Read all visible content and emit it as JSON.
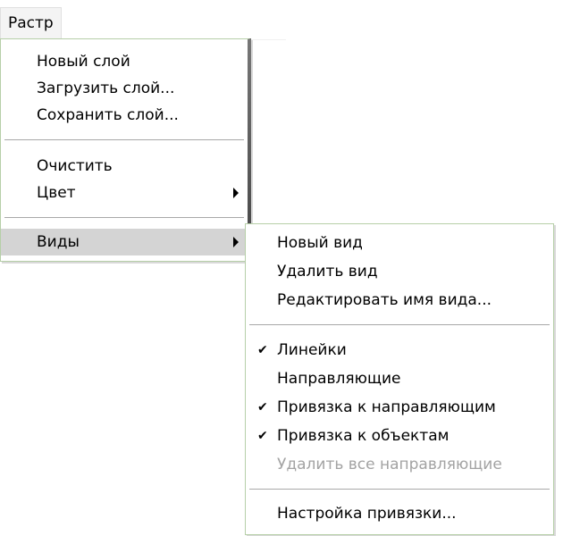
{
  "menubar": {
    "raster_label": "Растр"
  },
  "main_menu": {
    "new_layer": "Новый слой",
    "load_layer": "Загрузить слой...",
    "save_layer": "Сохранить слой...",
    "clear": "Очистить",
    "color": "Цвет",
    "views": "Виды"
  },
  "views_submenu": {
    "new_view": "Новый вид",
    "delete_view": "Удалить вид",
    "edit_view_name": "Редактировать имя вида...",
    "rulers": "Линейки",
    "guides": "Направляющие",
    "snap_to_guides": "Привязка к направляющим",
    "snap_to_objects": "Привязка к объектам",
    "delete_all_guides": "Удалить все направляющие",
    "snap_settings": "Настройка привязки...",
    "check_glyph": "✔"
  },
  "colors": {
    "highlight": "#d4d4d4",
    "disabled_text": "#a3a3a3",
    "menu_border": "#b6cfa8"
  }
}
